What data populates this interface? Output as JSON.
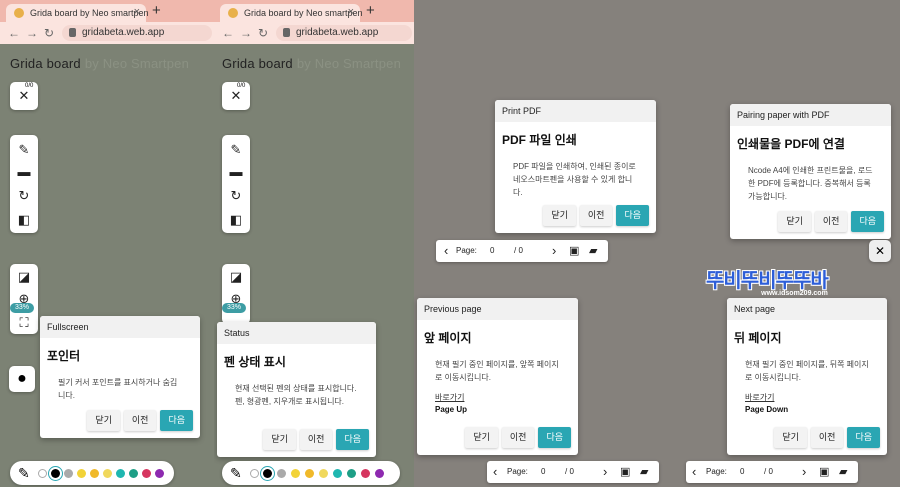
{
  "browser": {
    "tab_title": "Grida board by Neo smartpen",
    "url": "gridabeta.web.app",
    "close_glyph": "×",
    "new_tab_glyph": "+"
  },
  "board": {
    "title": "Grida board",
    "subtitle": "by Neo Smartpen",
    "pen_counter": "0/0",
    "zoom": "33%"
  },
  "tooltips": {
    "fullscreen": {
      "header": "Fullscreen",
      "title": "포인터",
      "body": "필기 커서 포인트를 표시하거나 숨깁니다."
    },
    "status": {
      "header": "Status",
      "title": "펜 상태 표시",
      "body": "현재 선택된 펜의 상태를 표시합니다. 펜, 형광펜, 지우개로 표시됩니다."
    },
    "print": {
      "header": "Print PDF",
      "title": "PDF 파일 인쇄",
      "body": "PDF 파일을 인쇄하여, 인쇄된 종이로 네오스마트펜을 사용할 수 있게 합니다."
    },
    "pairing": {
      "header": "Pairing paper with PDF",
      "title": "인쇄물을 PDF에 연결",
      "body": "Ncode A4에 인쇄한 프린트물을, 로드한 PDF에 등록합니다. 중복해서 등록 가능합니다."
    },
    "prev": {
      "header": "Previous page",
      "title": "앞 페이지",
      "body": "현재 필기 중인 페이지를, 앞쪽 페이지로 이동시킵니다.",
      "link": "바로가기",
      "key": "Page Up"
    },
    "next": {
      "header": "Next page",
      "title": "뒤 페이지",
      "body": "현재 필기 중인 페이지를, 뒤쪽 페이지로 이동시킵니다.",
      "link": "바로가기",
      "key": "Page Down"
    }
  },
  "buttons": {
    "close": "닫기",
    "prev": "이전",
    "next": "다음"
  },
  "pager": {
    "label": "Page:",
    "current": "0",
    "total": "/ 0",
    "prev_glyph": "‹",
    "next_glyph": "›"
  },
  "watermark": {
    "text": "뚜비뚜비뚜뚜바",
    "site": "www.idsom209.com"
  },
  "palette": {
    "colors": [
      "#ffffff",
      "#000000",
      "#aaaaaa",
      "#f2d338",
      "#f0b92a",
      "#f0d85c",
      "#1fb7b0",
      "#1e9f86",
      "#d6365f",
      "#8e2ab0"
    ]
  },
  "colors": {
    "accent": "#2aa6b3",
    "tabbar": "#f0b8ad",
    "canvas_left": "#7c8274",
    "canvas_right": "#85817c"
  }
}
